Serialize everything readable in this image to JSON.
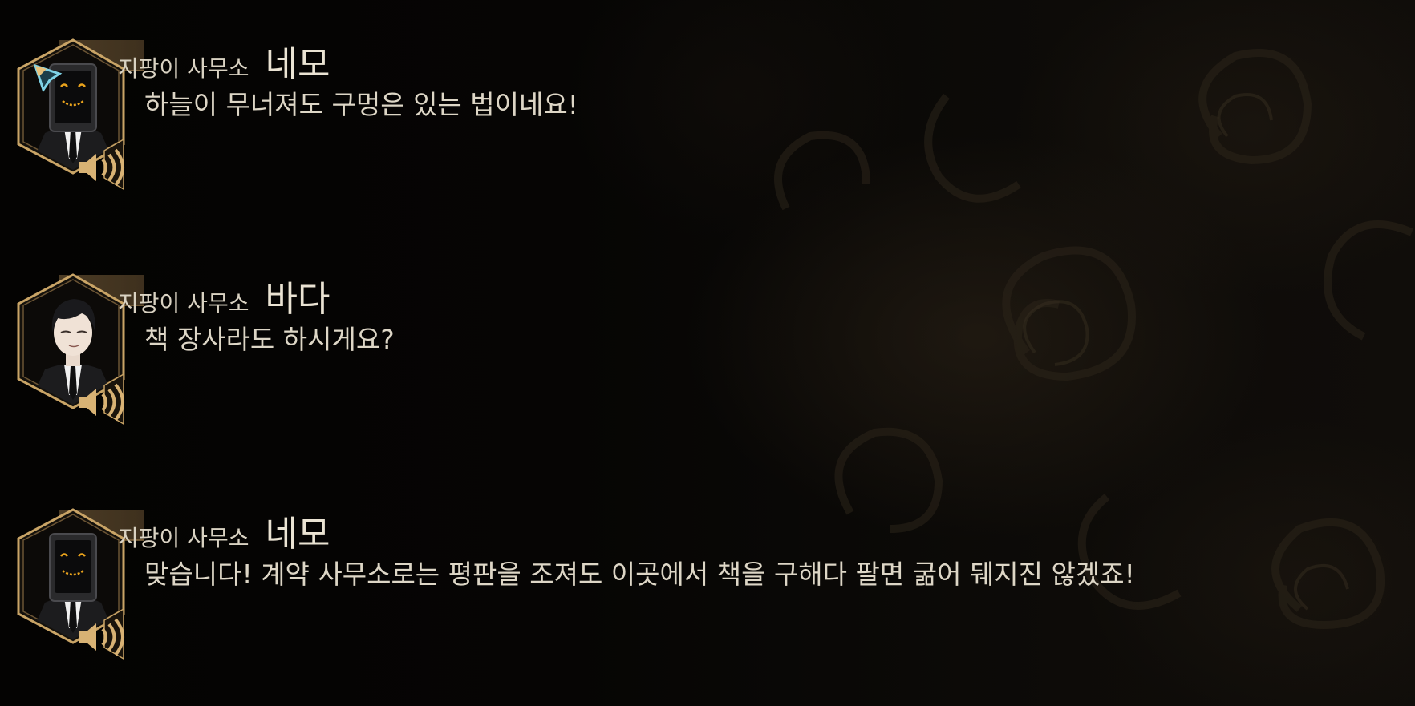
{
  "log": {
    "entries": [
      {
        "affiliation": "지팡이 사무소",
        "name": "네모",
        "text": "하늘이 무너져도 구멍은 있는 법이네요!",
        "portrait": "tv-head-agent",
        "voice_icon": "speaker-icon",
        "selected": true
      },
      {
        "affiliation": "지팡이 사무소",
        "name": "바다",
        "text": "책 장사라도 하시게요?",
        "portrait": "black-haired-agent",
        "voice_icon": "speaker-icon",
        "selected": false
      },
      {
        "affiliation": "지팡이 사무소",
        "name": "네모",
        "text": "맞습니다! 계약 사무소로는 평판을 조져도 이곳에서 책을 구해다 팔면 굶어 뒈지진 않겠죠!",
        "portrait": "tv-head-agent",
        "voice_icon": "speaker-icon",
        "selected": false
      }
    ]
  },
  "colors": {
    "frame_gold": "#b8935a",
    "frame_glow": "#e0b878",
    "text": "#ddd6c6",
    "screen_face": "#e8a21c",
    "cursor": "#7fd3e6"
  }
}
